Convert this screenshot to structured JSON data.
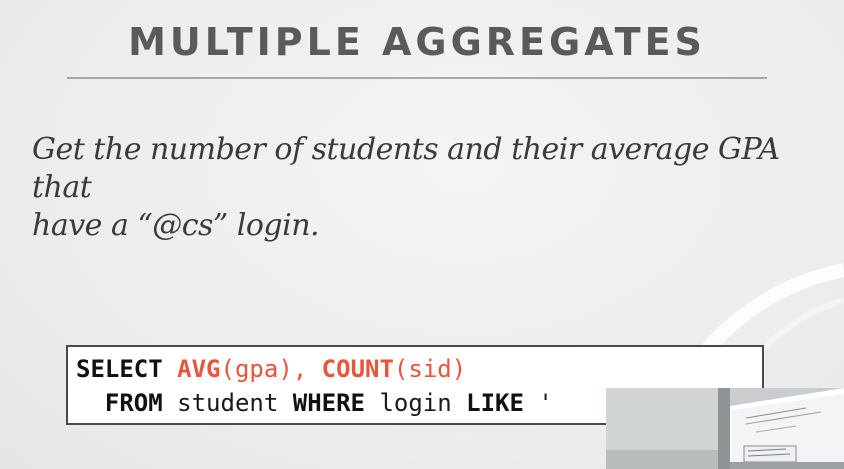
{
  "slide": {
    "title": "MULTIPLE AGGREGATES",
    "question_line1": "Get the number of students and their average GPA that",
    "question_line2": "have a “@cs” login."
  },
  "code": {
    "line1": {
      "select": "SELECT",
      "sp1": " ",
      "avg": "AVG",
      "avg_args": "(gpa), ",
      "count": "COUNT",
      "count_args": "(sid)"
    },
    "line2": {
      "indent": "  ",
      "from": "FROM",
      "table": " student ",
      "where": "WHERE",
      "cond": " login ",
      "like": "LIKE",
      "pattern": " '"
    }
  },
  "colors": {
    "function_accent": "#e8553a",
    "title_gray": "#5a5a5a"
  }
}
